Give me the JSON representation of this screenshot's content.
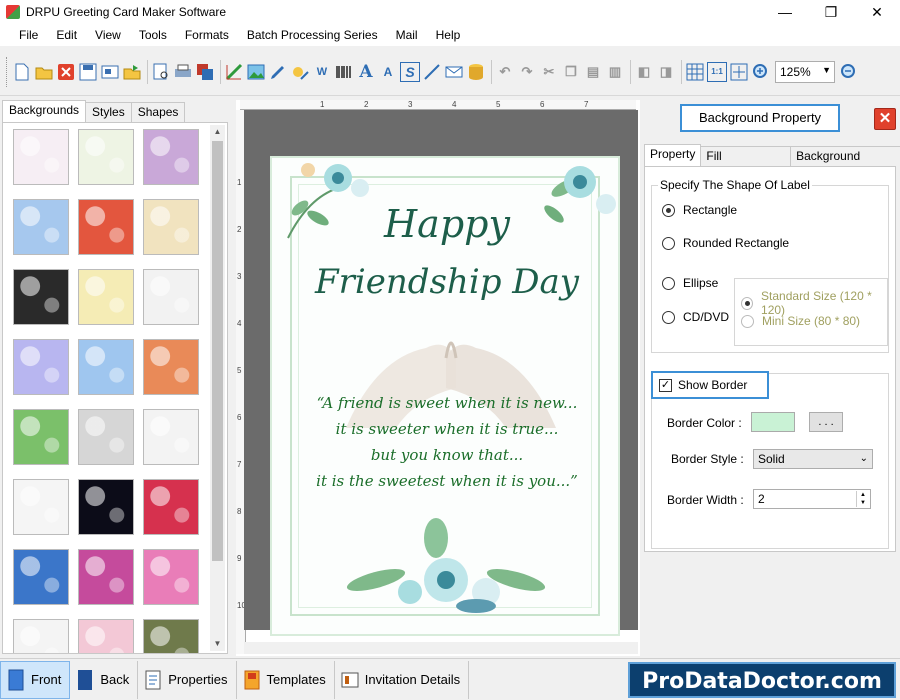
{
  "app": {
    "title": "DRPU Greeting Card Maker Software",
    "brand": "ProDataDoctor.com",
    "window_controls": [
      "—",
      "❐",
      "✕"
    ]
  },
  "menu": [
    "File",
    "Edit",
    "View",
    "Tools",
    "Formats",
    "Batch Processing Series",
    "Mail",
    "Help"
  ],
  "toolbar": {
    "zoom": "125%"
  },
  "left_panel": {
    "tabs": [
      "Backgrounds",
      "Styles",
      "Shapes"
    ],
    "active_tab": "Backgrounds",
    "thumb_colors": [
      "#f6eef4",
      "#eef4e4",
      "#c9a8d8",
      "#a6c8ee",
      "#e3563e",
      "#f1e3bf",
      "#2a2a2a",
      "#f5ecb5",
      "#f2f2f2",
      "#b8b6f0",
      "#9fc6ef",
      "#e98a58",
      "#7bc06a",
      "#d6d6d6",
      "#f3f3f3",
      "#f5f5f5",
      "#0c0c18",
      "#d6314e",
      "#3b76c9",
      "#c54b9c",
      "#e97db8",
      "#f4f4f4",
      "#f3c8d6",
      "#6f7a4b"
    ]
  },
  "card": {
    "title_line1": "Happy",
    "title_line2": "Friendship Day",
    "quote_lines": [
      "“A friend is sweet when it is new...",
      "it is sweeter when it is true...",
      "but you know that...",
      "it is the sweetest when it is you...”"
    ]
  },
  "ruler": {
    "top_marks": [
      "1",
      "2",
      "3",
      "4",
      "5",
      "6",
      "7"
    ],
    "left_marks": [
      "1",
      "2",
      "3",
      "4",
      "5",
      "6",
      "7",
      "8",
      "9",
      "10"
    ]
  },
  "right_panel": {
    "title": "Background Property",
    "close_label": "✕",
    "tabs": [
      "Property",
      "Fill Background",
      "Background Effects"
    ],
    "active_tab": "Property",
    "shape_group_label": "Specify The Shape Of Label",
    "shapes": [
      "Rectangle",
      "Rounded Rectangle",
      "Ellipse",
      "CD/DVD"
    ],
    "selected_shape": "Rectangle",
    "cd_sizes": [
      "Standard Size (120 * 120)",
      "Mini Size (80 * 80)"
    ],
    "show_border_label": "Show Border",
    "show_border_checked": true,
    "border_color_label": "Border Color :",
    "border_color_value": "#c9f2d5",
    "browse_label": ". . .",
    "border_style_label": "Border Style :",
    "border_style_value": "Solid",
    "border_width_label": "Border Width :",
    "border_width_value": "2"
  },
  "bottom_bar": {
    "buttons": [
      "Front",
      "Back",
      "Properties",
      "Templates",
      "Invitation Details"
    ],
    "active": "Front"
  }
}
